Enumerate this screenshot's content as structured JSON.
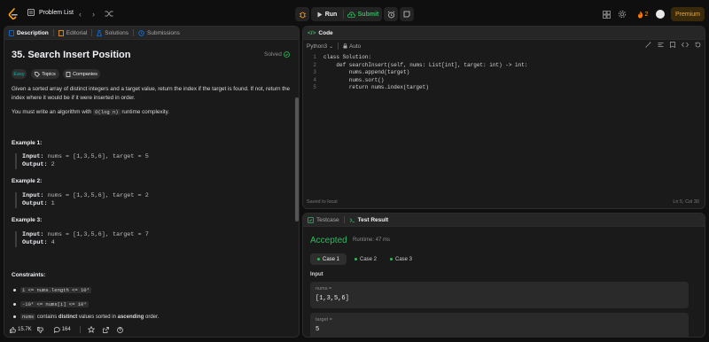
{
  "nav": {
    "problem_list": "Problem List",
    "run": "Run",
    "submit": "Submit",
    "streak": "2",
    "premium": "Premium"
  },
  "desc_panel": {
    "tabs": [
      "Description",
      "Editorial",
      "Solutions",
      "Submissions"
    ],
    "title": "35. Search Insert Position",
    "solved": "Solved",
    "chips": [
      "Easy",
      "Topics",
      "Companies"
    ],
    "p1": "Given a sorted array of distinct integers and a target value, return the index if the target is found. If not, return the index where it would be if it were inserted in order.",
    "p2_pre": "You must write an algorithm with",
    "p2_code": "O(log n)",
    "p2_post": "runtime complexity.",
    "examples": [
      {
        "heading": "Example 1:",
        "input": "nums = [1,3,5,6], target = 5",
        "output": "2"
      },
      {
        "heading": "Example 2:",
        "input": "nums = [1,3,5,6], target = 2",
        "output": "1"
      },
      {
        "heading": "Example 3:",
        "input": "nums = [1,3,5,6], target = 7",
        "output": "4"
      }
    ],
    "input_label": "Input:",
    "output_label": "Output:",
    "constraints_heading": "Constraints:",
    "constraint1": "1 <= nums.length <= 10⁴",
    "constraint2": "-10⁴ <= nums[i] <= 10⁴",
    "constraint3_code": "nums",
    "constraint3_a": "contains",
    "constraint3_b": "distinct",
    "constraint3_c": "values sorted in",
    "constraint3_d": "ascending",
    "constraint3_e": "order.",
    "likes": "15.7K",
    "comments": "164"
  },
  "code_panel": {
    "tab": "Code",
    "language": "Python3",
    "auto": "Auto",
    "lines": [
      "class Solution:",
      "    def searchInsert(self, nums: List[int], target: int) -> int:",
      "        nums.append(target)",
      "        nums.sort()",
      "        return nums.index(target)"
    ],
    "status": "Saved to local",
    "position": "Ln 5, Col 30"
  },
  "test_panel": {
    "tabs": [
      "Testcase",
      "Test Result"
    ],
    "verdict": "Accepted",
    "runtime": "Runtime: 47 ms",
    "cases": [
      "Case 1",
      "Case 2",
      "Case 3"
    ],
    "input_label": "Input",
    "vars": [
      {
        "name": "nums =",
        "value": "[1,3,5,6]"
      },
      {
        "name": "target =",
        "value": "5"
      }
    ]
  },
  "colors": {
    "accent": "#ffa116",
    "success": "#2cbb5d",
    "blue": "#007aff"
  }
}
